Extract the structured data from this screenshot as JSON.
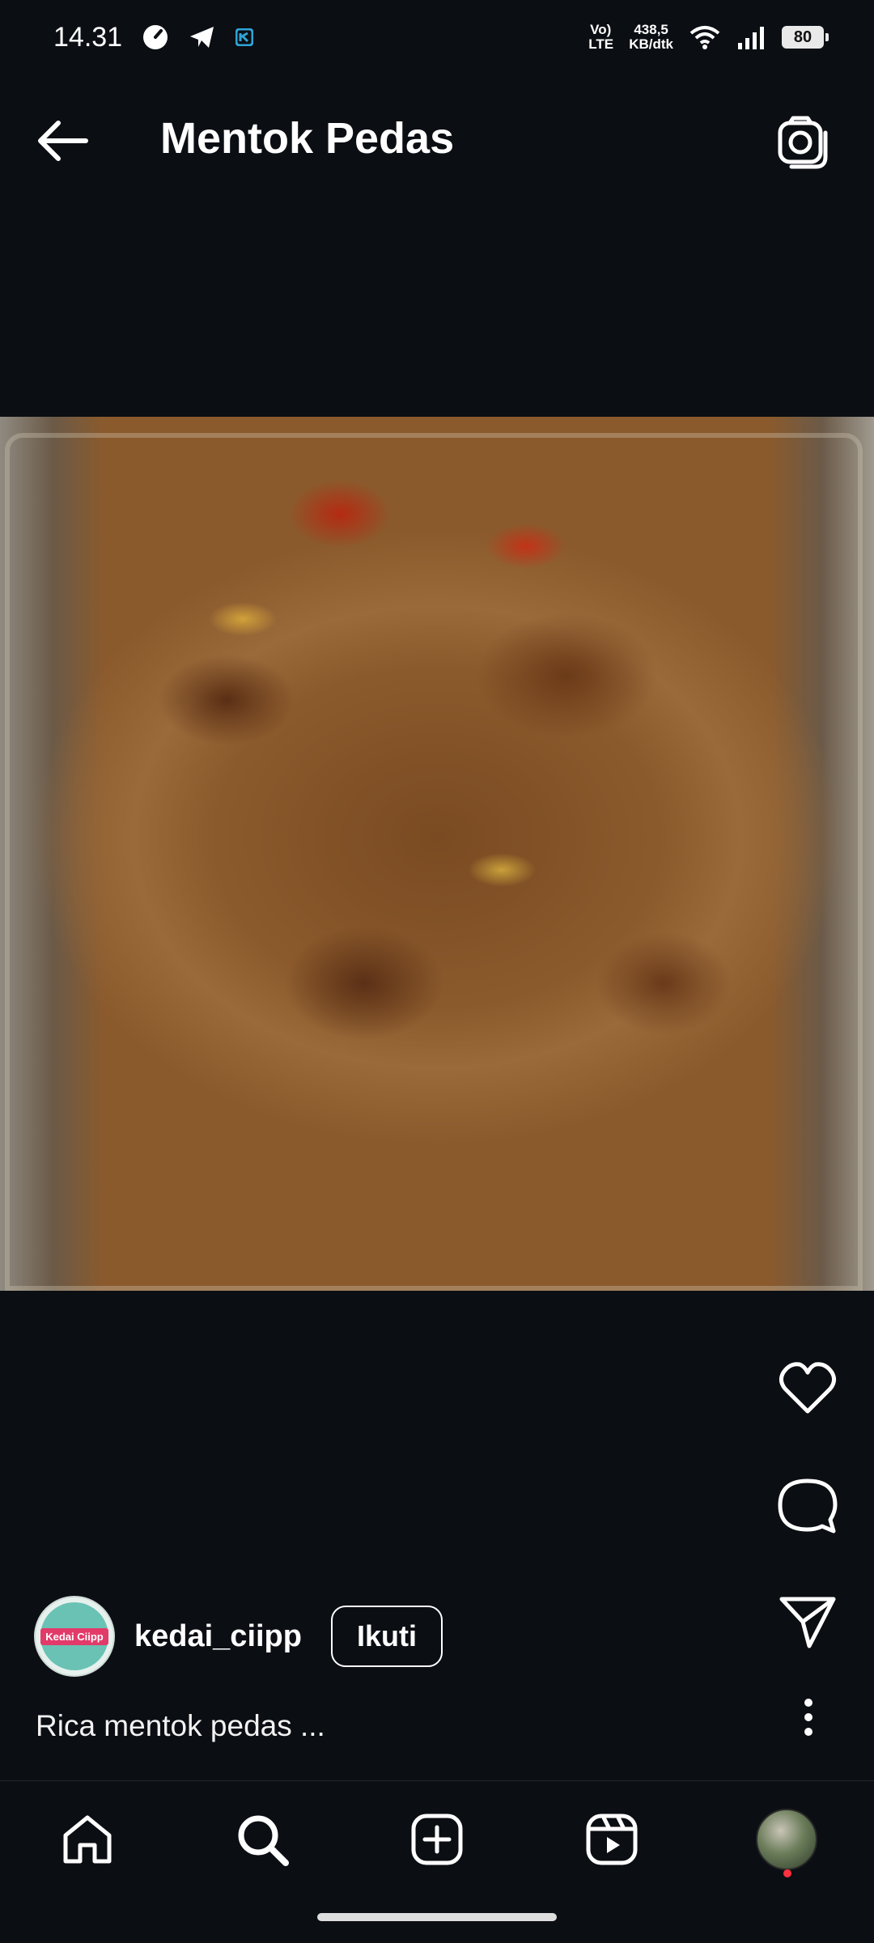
{
  "status_bar": {
    "time": "14.31",
    "network_type": "Vo) LTE",
    "speed_value": "438,5",
    "speed_unit": "KB/dtk",
    "battery": "80",
    "icons": [
      "speedometer-icon",
      "telegram-icon",
      "app-icon",
      "wifi-icon",
      "signal-icon"
    ]
  },
  "header": {
    "title": "Mentok Pedas",
    "back_icon": "back-arrow-icon",
    "camera_icon": "camera-icon"
  },
  "post": {
    "image_description_icon": "food-photo",
    "author": {
      "username": "kedai_ciipp",
      "avatar_badge": "Kedai Ciipp",
      "follow_label": "Ikuti"
    },
    "caption": "Rica mentok pedas ..."
  },
  "actions": [
    "heart-icon",
    "comment-icon",
    "share-icon",
    "more-icon"
  ],
  "bottom_nav": [
    "home-icon",
    "search-icon",
    "create-icon",
    "reels-icon",
    "profile-icon"
  ],
  "colors": {
    "background": "#0b0e13",
    "text": "#ffffff",
    "notification_dot": "#ff3040"
  }
}
